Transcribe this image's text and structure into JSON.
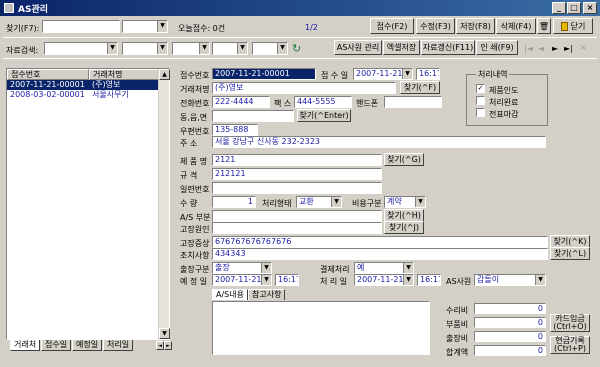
{
  "window": {
    "title": "AS관리",
    "minimize": "_",
    "maximize": "□",
    "close": "×"
  },
  "toolbar": {
    "find_label": "찾기(F7):",
    "today_label": "오늘접수: 0건",
    "page": "1/2",
    "receive_btn": "접수(F2)",
    "edit_btn": "수정(F3)",
    "save_btn": "저장(F8)",
    "delete_btn": "삭제(F4)",
    "close_btn": "닫기"
  },
  "search_bar": {
    "label": "자료검색:",
    "as_staff_btn": "AS사원 관리",
    "excel_btn": "엑셀저장",
    "refresh_btn": "자료갱신(F11)",
    "print_btn": "인 쇄(F9)",
    "nav": [
      "|◄",
      "◄",
      "►",
      "►|",
      "×"
    ]
  },
  "list": {
    "headers": [
      "접수번호",
      "거래처명"
    ],
    "rows": [
      {
        "no": "2007-11-21-00001",
        "name": "(주)영보",
        "selected": true
      },
      {
        "no": "2008-03-02-00001",
        "name": "서울사무기",
        "selected": false
      }
    ],
    "tabs": [
      "거래처",
      "접수일",
      "예정일",
      "처리일"
    ]
  },
  "form": {
    "receipt_no_label": "접수번호",
    "receipt_no": "2007-11-21-00001",
    "receive_date_label": "접 수 일",
    "receive_date": "2007-11-21",
    "receive_time": "16:17",
    "client_label": "거래처명",
    "client": "(주)영보",
    "find_f": "찾기(^F)",
    "phone_label": "전화번호",
    "phone": "222-4444",
    "fax_label": "팩 스",
    "fax": "444-5555",
    "mobile_label": "핸드폰",
    "mobile": "",
    "dong_label": "동,읍,면",
    "dong": "",
    "find_enter": "찾기(^Enter)",
    "zip_label": "우편번호",
    "zip": "135-888",
    "addr_label": "주 소",
    "addr": "서울 강남구 신사동 232-2323",
    "product_label": "제 품 명",
    "product": "2121",
    "find_g": "찾기(^G)",
    "spec_label": "규 격",
    "spec": "212121",
    "serial_label": "일련번호",
    "serial": "",
    "qty_label": "수 량",
    "qty": "1",
    "proc_type_label": "처리형태",
    "proc_type": "교환",
    "cost_type_label": "비용구분",
    "cost_type": "계약",
    "as_part_label": "A/S 부분",
    "as_part": "",
    "find_h": "찾기(^H)",
    "cause_label": "고장원인",
    "cause": "",
    "find_j": "찾기(^J)",
    "symptom_label": "고장증상",
    "symptom": "676767676767676",
    "find_k": "찾기(^K)",
    "action_label": "조치사항",
    "action": "434343",
    "find_l": "찾기(^L)",
    "dispatch_label": "출장구분",
    "dispatch": "출장",
    "pay_label": "결제처리",
    "pay": "예",
    "plan_date_label": "예 정 일",
    "plan_date": "2007-11-21",
    "plan_time": "16:17",
    "proc_date_label": "처 리 일",
    "proc_date": "2007-11-21",
    "proc_time": "16:17",
    "as_staff_label": "AS사원",
    "as_staff": "갑돌이",
    "tab_content": "A/S내용",
    "tab_notes": "참고사항",
    "repair_label": "수리비",
    "repair": "0",
    "parts_label": "부품비",
    "parts": "0",
    "trip_label": "출장비",
    "trip": "0",
    "total_label": "합계액",
    "total": "0",
    "card_btn_1": "카드입금",
    "card_btn_2": "(Ctrl+O)",
    "cash_btn_1": "현금기록",
    "cash_btn_2": "(Ctrl+P)"
  },
  "status_group": {
    "title": "처리내역",
    "items": [
      {
        "label": "제품인도",
        "checked": true
      },
      {
        "label": "처리완료",
        "checked": false
      },
      {
        "label": "전표마감",
        "checked": false
      }
    ]
  }
}
